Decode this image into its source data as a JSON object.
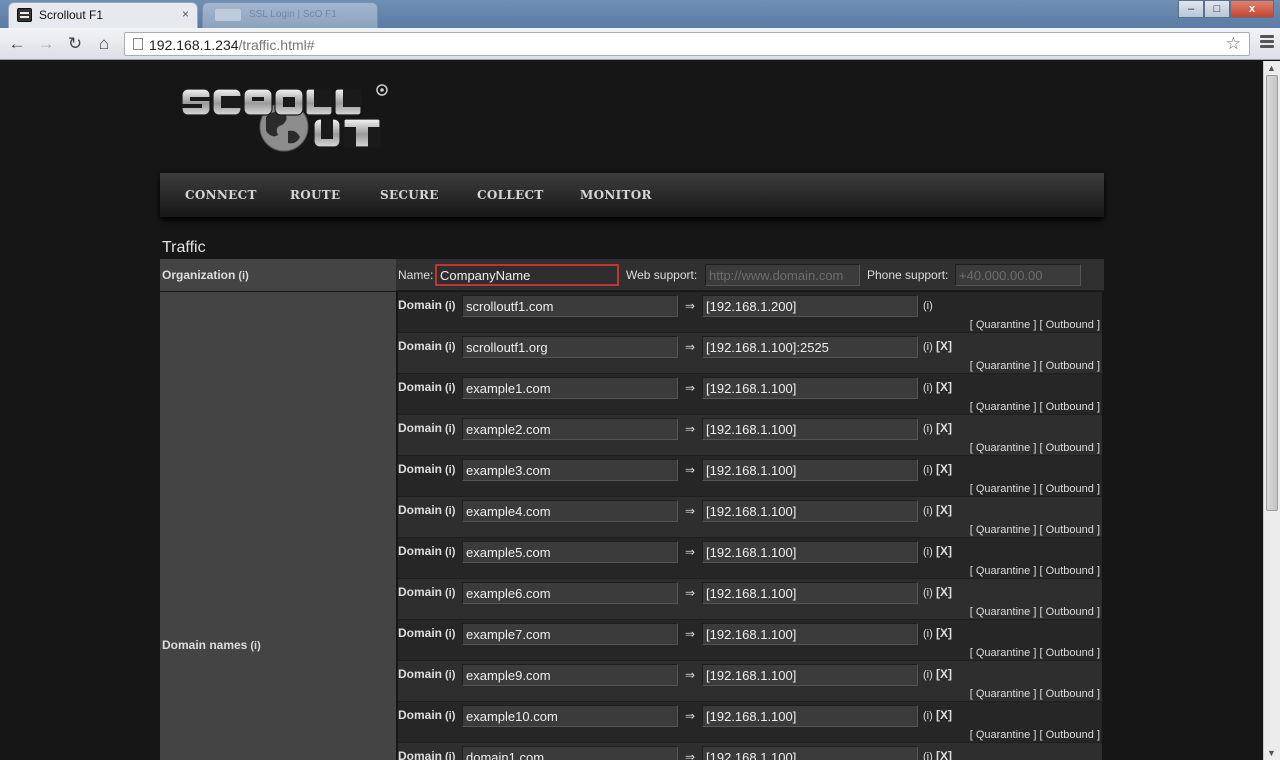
{
  "browser": {
    "active_tab_title": "Scrollout F1",
    "inactive_tab_text": "SSL Login | ScO F1",
    "tab_close_glyph": "×",
    "url_host": "192.168.1.234",
    "url_path": "/traffic.html#",
    "minimize_glyph": "–",
    "maximize_glyph": "□",
    "close_glyph": "x"
  },
  "nav": {
    "items": [
      "CONNECT",
      "ROUTE",
      "SECURE",
      "COLLECT",
      "MONITOR"
    ]
  },
  "page": {
    "title": "Traffic",
    "info_glyph": "(i)"
  },
  "organization": {
    "label": "Organization",
    "name_label": "Name:",
    "name_value": "CompanyName",
    "web_label": "Web support:",
    "web_placeholder": "http://www.domain.com",
    "phone_label": "Phone support:",
    "phone_placeholder": "+40.000.00.00"
  },
  "domains": {
    "label": "Domain names",
    "row_label": "Domain",
    "arrow": "⇒",
    "delete_label": "[X]",
    "quarantine_label": "[ Quarantine ]",
    "outbound_label": "[ Outbound ]",
    "rows": [
      {
        "domain": "scrolloutf1.com",
        "target": "[192.168.1.200]",
        "deletable": false
      },
      {
        "domain": "scrolloutf1.org",
        "target": "[192.168.1.100]:2525",
        "deletable": true
      },
      {
        "domain": "example1.com",
        "target": "[192.168.1.100]",
        "deletable": true
      },
      {
        "domain": "example2.com",
        "target": "[192.168.1.100]",
        "deletable": true
      },
      {
        "domain": "example3.com",
        "target": "[192.168.1.100]",
        "deletable": true
      },
      {
        "domain": "example4.com",
        "target": "[192.168.1.100]",
        "deletable": true
      },
      {
        "domain": "example5.com",
        "target": "[192.168.1.100]",
        "deletable": true
      },
      {
        "domain": "example6.com",
        "target": "[192.168.1.100]",
        "deletable": true
      },
      {
        "domain": "example7.com",
        "target": "[192.168.1.100]",
        "deletable": true
      },
      {
        "domain": "example9.com",
        "target": "[192.168.1.100]",
        "deletable": true
      },
      {
        "domain": "example10.com",
        "target": "[192.168.1.100]",
        "deletable": true
      },
      {
        "domain": "domain1.com",
        "target": "[192.168.1.100]",
        "deletable": true
      }
    ]
  }
}
